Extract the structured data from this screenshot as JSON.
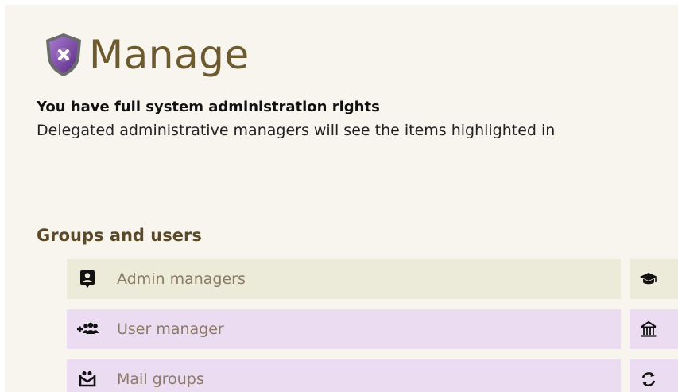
{
  "header": {
    "title": "Manage",
    "rights_text": "You have full system administration rights",
    "delegated_text": "Delegated administrative managers will see the items highlighted in"
  },
  "groups_and_users": {
    "heading": "Groups and users",
    "items": [
      {
        "label": "Admin managers",
        "icon": "person-badge-icon"
      },
      {
        "label": "User manager",
        "icon": "add-users-icon"
      },
      {
        "label": "Mail groups",
        "icon": "mail-groups-icon"
      }
    ],
    "side_icons": [
      "graduation-cap-icon",
      "institution-icon",
      "sync-icon"
    ]
  },
  "colors": {
    "background": "#f7f5ed",
    "title": "#6d5a2e",
    "admin_row": "#ecebda",
    "delegated_row": "#ecdcf2",
    "label": "#8a7a66",
    "shield": "#7a3fa0"
  }
}
